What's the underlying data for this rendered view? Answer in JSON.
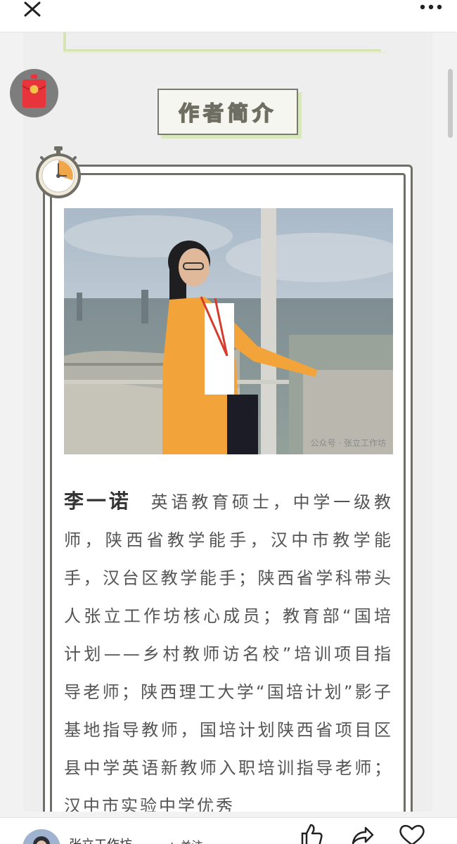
{
  "section": {
    "title": "作者简介"
  },
  "photo": {
    "watermark": "公众号 · 张立工作坊"
  },
  "bio": {
    "name": "李一诺",
    "text": "英语教育硕士，中学一级教师，陕西省教学能手，汉中市教学能手，汉台区教学能手；陕西省学科带头人张立工作坊核心成员；教育部“国培计划——乡村教师访名校”培训项目指导老师；陕西理工大学“国培计划”影子基地指导教师，国培计划陕西省项目区县中学英语新教师入职培训指导老师；汉中市实验中学优秀"
  },
  "footer": {
    "account_name": "张立工作坊",
    "follow_label": "+ 关注"
  },
  "icons": [
    "close-icon",
    "more-icon",
    "red-packet-icon",
    "timer-icon",
    "like-icon",
    "share-icon",
    "favorite-icon"
  ],
  "colors": {
    "accent": "#d9e7bd",
    "frame": "#6f6f68",
    "text": "#555555",
    "red_packet": "#e8353b"
  }
}
